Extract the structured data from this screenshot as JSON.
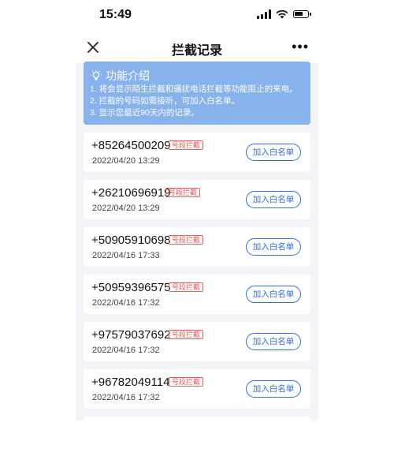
{
  "status": {
    "time": "15:49"
  },
  "nav": {
    "title": "拦截记录",
    "more": "•••"
  },
  "info": {
    "title": "功能介绍",
    "lines": [
      "1. 将会显示陌生拦截和骚扰电话拦截等功能阻止的来电。",
      "2. 拦截的号码如需接听，可加入白名单。",
      "3. 显示您最近90天内的记录。"
    ]
  },
  "records": [
    {
      "number": "+85264500209",
      "tag": "号段拦截",
      "date": "2022/04/20 13:29",
      "action": "加入白名单"
    },
    {
      "number": "+26210696919",
      "tag": "号段拦截",
      "date": "2022/04/20 13:29",
      "action": "加入白名单"
    },
    {
      "number": "+50905910698",
      "tag": "号段拦截",
      "date": "2022/04/16 17:33",
      "action": "加入白名单"
    },
    {
      "number": "+50959396575",
      "tag": "号段拦截",
      "date": "2022/04/16 17:32",
      "action": "加入白名单"
    },
    {
      "number": "+97579037692",
      "tag": "号段拦截",
      "date": "2022/04/16 17:32",
      "action": "加入白名单"
    },
    {
      "number": "+96782049114",
      "tag": "号段拦截",
      "date": "2022/04/16 17:32",
      "action": "加入白名单"
    }
  ],
  "colors": {
    "accent": "#2f6de0",
    "tag": "#e25b57",
    "info_bg": "#87b2ec"
  }
}
